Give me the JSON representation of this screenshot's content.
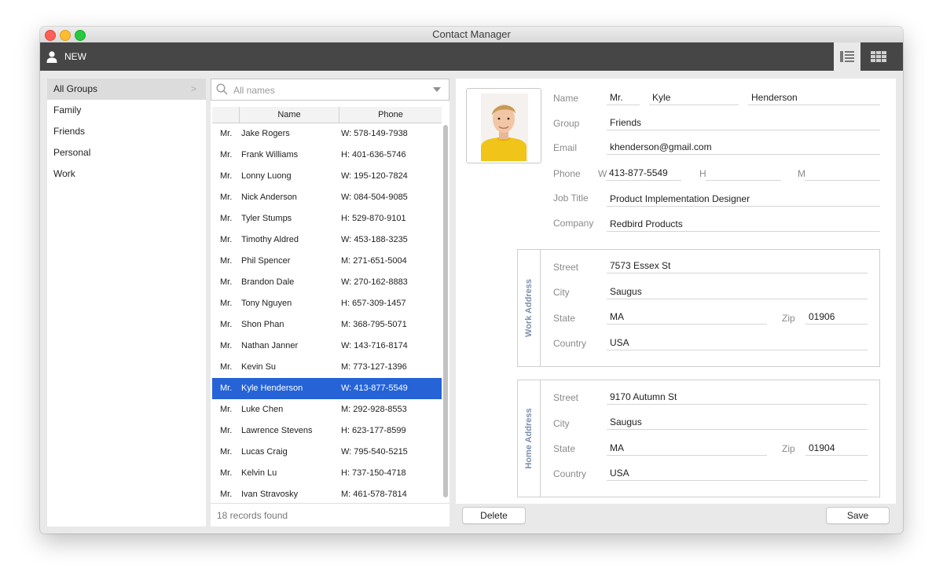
{
  "window": {
    "title": "Contact Manager"
  },
  "toolbar": {
    "new_label": "NEW"
  },
  "groups": [
    "All Groups",
    "Family",
    "Friends",
    "Personal",
    "Work"
  ],
  "search": {
    "placeholder": "All names"
  },
  "list": {
    "columns": {
      "name": "Name",
      "phone": "Phone"
    },
    "rows": [
      {
        "title": "Mr.",
        "name": "Jake Rogers",
        "phone": "W: 578-149-7938"
      },
      {
        "title": "Mr.",
        "name": "Frank Williams",
        "phone": "H: 401-636-5746"
      },
      {
        "title": "Mr.",
        "name": "Lonny Luong",
        "phone": "W: 195-120-7824"
      },
      {
        "title": "Mr.",
        "name": "Nick Anderson",
        "phone": "W: 084-504-9085"
      },
      {
        "title": "Mr.",
        "name": "Tyler Stumps",
        "phone": "H: 529-870-9101"
      },
      {
        "title": "Mr.",
        "name": "Timothy Aldred",
        "phone": "W: 453-188-3235"
      },
      {
        "title": "Mr.",
        "name": "Phil Spencer",
        "phone": "M: 271-651-5004"
      },
      {
        "title": "Mr.",
        "name": "Brandon Dale",
        "phone": "W: 270-162-8883"
      },
      {
        "title": "Mr.",
        "name": "Tony Nguyen",
        "phone": "H: 657-309-1457"
      },
      {
        "title": "Mr.",
        "name": "Shon Phan",
        "phone": "M: 368-795-5071"
      },
      {
        "title": "Mr.",
        "name": "Nathan Janner",
        "phone": "W: 143-716-8174"
      },
      {
        "title": "Mr.",
        "name": "Kevin Su",
        "phone": "M: 773-127-1396"
      },
      {
        "title": "Mr.",
        "name": "Kyle Henderson",
        "phone": "W: 413-877-5549"
      },
      {
        "title": "Mr.",
        "name": "Luke Chen",
        "phone": "M: 292-928-8553"
      },
      {
        "title": "Mr.",
        "name": "Lawrence Stevens",
        "phone": "H: 623-177-8599"
      },
      {
        "title": "Mr.",
        "name": "Lucas Craig",
        "phone": "W: 795-540-5215"
      },
      {
        "title": "Mr.",
        "name": "Kelvin Lu",
        "phone": "H: 737-150-4718"
      },
      {
        "title": "Mr.",
        "name": "Ivan Stravosky",
        "phone": "M: 461-578-7814"
      }
    ],
    "footer": "18 records found"
  },
  "detail": {
    "labels": {
      "name": "Name",
      "group": "Group",
      "email": "Email",
      "phone": "Phone",
      "job_title": "Job Title",
      "company": "Company",
      "street": "Street",
      "city": "City",
      "state": "State",
      "zip": "Zip",
      "country": "Country",
      "phone_w": "W",
      "phone_h": "H",
      "phone_m": "M"
    },
    "contact": {
      "title": "Mr.",
      "first": "Kyle",
      "last": "Henderson",
      "group": "Friends",
      "email": "khenderson@gmail.com",
      "phone_w": "413-877-5549",
      "phone_h": "",
      "phone_m": "",
      "job_title": "Product Implementation Designer",
      "company": "Redbird Products"
    },
    "work_address": {
      "heading": "Work Address",
      "street": "7573 Essex St",
      "city": "Saugus",
      "state": "MA",
      "zip": "01906",
      "country": "USA"
    },
    "home_address": {
      "heading": "Home Address",
      "street": "9170 Autumn St",
      "city": "Saugus",
      "state": "MA",
      "zip": "01904",
      "country": "USA"
    }
  },
  "buttons": {
    "delete": "Delete",
    "save": "Save"
  },
  "colors": {
    "toolbar": "#464646",
    "selection": "#2563d6",
    "section_heading": "#7b8fae",
    "shirt": "#f0c419"
  }
}
